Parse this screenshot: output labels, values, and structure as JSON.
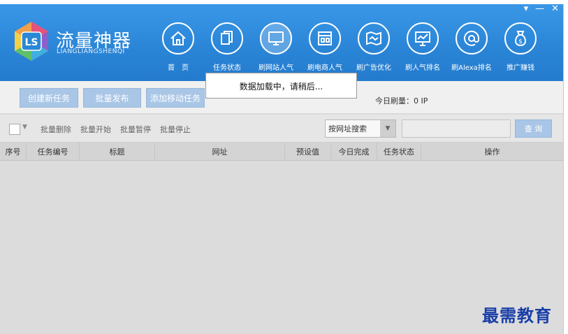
{
  "window_controls": {
    "pin": "▾",
    "minimize": "—",
    "close": "✕"
  },
  "brand": {
    "title": "流量神器",
    "subtitle": "LIANGLIANGSHENQI",
    "logo_text": "LS"
  },
  "nav": [
    {
      "label": "首　页",
      "icon": "home-icon"
    },
    {
      "label": "任务状态",
      "icon": "documents-icon"
    },
    {
      "label": "刷网站人气",
      "icon": "monitor-icon",
      "active": true
    },
    {
      "label": "刷电商人气",
      "icon": "store-icon"
    },
    {
      "label": "刷广告优化",
      "icon": "ad-map-icon"
    },
    {
      "label": "刷人气排名",
      "icon": "chart-board-icon"
    },
    {
      "label": "刷Alexa排名",
      "icon": "at-icon"
    },
    {
      "label": "推广赚钱",
      "icon": "money-bag-icon"
    }
  ],
  "toolbar": {
    "create_task": "创建新任务",
    "batch_publish": "批量发布",
    "add_mobile_task": "添加移动任务",
    "today_traffic": "今日刷量：0 IP"
  },
  "loading": {
    "message": "数据加载中，请稍后..."
  },
  "filter": {
    "batch_delete": "批量删除",
    "batch_start": "批量开始",
    "batch_pause": "批量暂停",
    "batch_stop": "批量停止",
    "search_mode": "按网址搜索",
    "search_value": "",
    "search_button": "查 询"
  },
  "table": {
    "columns": [
      "序号",
      "任务编号",
      "标题",
      "网址",
      "预设值",
      "今日完成",
      "任务状态",
      "操作"
    ],
    "rows": []
  },
  "watermark": "最需教育"
}
